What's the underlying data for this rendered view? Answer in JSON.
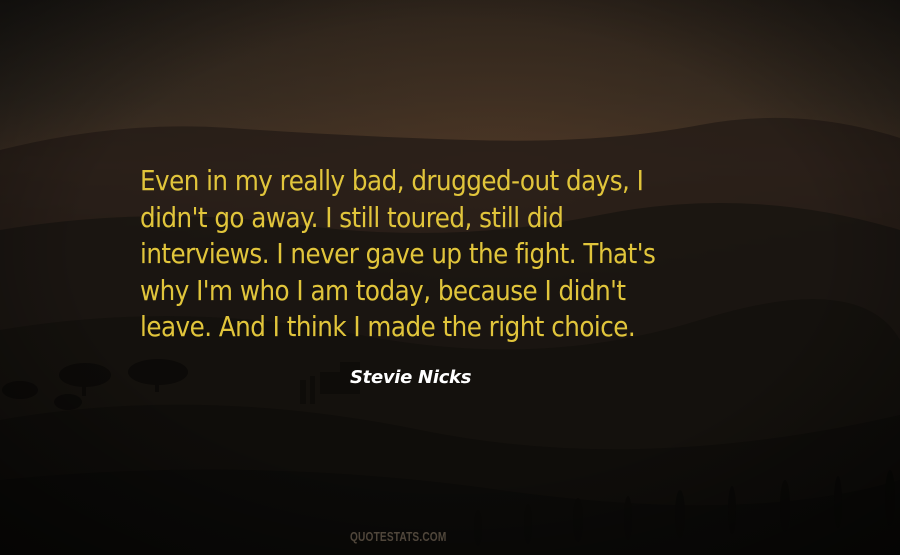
{
  "quote": {
    "lines": [
      "Even in my really bad, drugged-out days, I",
      "didn't go away. I still toured, still did",
      "interviews. I never gave up the fight. That's",
      "why I'm who I am today, because I didn't",
      "leave. And I think I made the right choice."
    ]
  },
  "author": {
    "name": "Stevie Nicks"
  },
  "watermark": {
    "text": "QUOTESTATS.COM"
  },
  "colors": {
    "quote_text": "#e1c53b",
    "author_text": "#ffffff",
    "watermark_text": "#8a7a66",
    "sky_top": "#1c1915",
    "sky_glow": "#4a3626",
    "hills_dark": "#0a0907"
  }
}
